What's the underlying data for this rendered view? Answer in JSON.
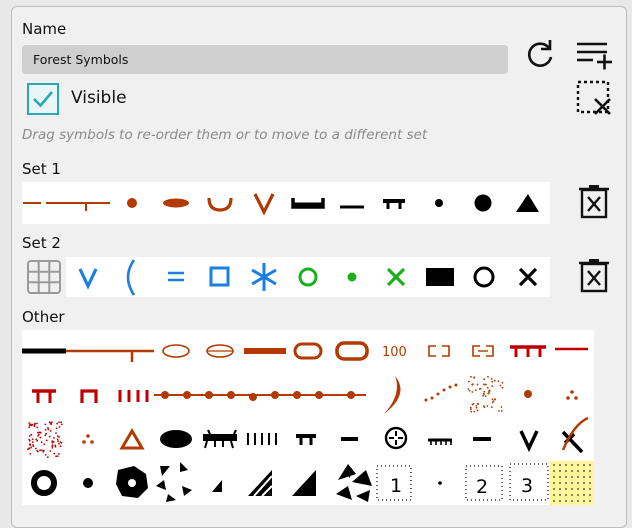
{
  "name_label": "Name",
  "name_value": "Forest Symbols",
  "visible_label": "Visible",
  "visible_checked": true,
  "hint": "Drag symbols to re-order them or to move to a different set",
  "sets": [
    {
      "label": "Set 1"
    },
    {
      "label": "Set 2"
    }
  ],
  "other_label": "Other",
  "icons": {
    "refresh": "refresh-icon",
    "add_list": "playlist-add-icon",
    "clear_selection": "deselect-icon",
    "delete_set": "delete-icon",
    "grid": "grid-icon"
  },
  "other_texts": {
    "hundred": "100",
    "one": "1",
    "two": "2",
    "three": "3"
  },
  "colors": {
    "accent": "#2aa6b4",
    "brown": "#b23a00",
    "blue": "#1a7fe0",
    "green": "#19b019",
    "red": "#c00000"
  }
}
